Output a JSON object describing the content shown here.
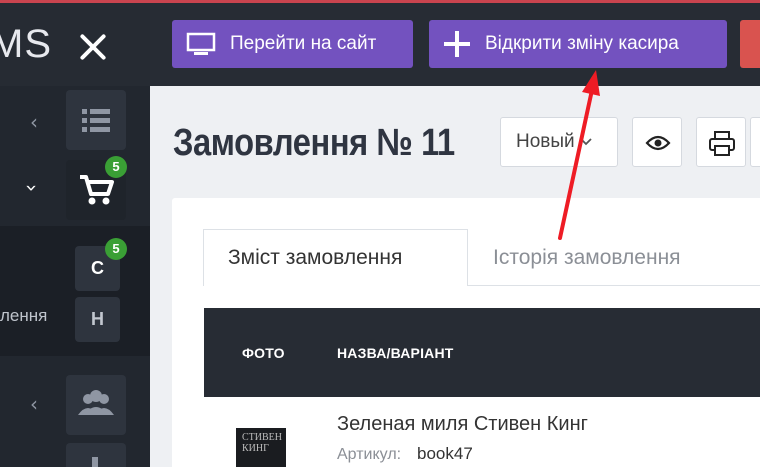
{
  "brand": {
    "logo_text": "MS"
  },
  "sidebar": {
    "badges": {
      "orders": "5",
      "sub_orders": "5"
    },
    "sub_items": {
      "first": "С",
      "second": "Н"
    },
    "section_label": "лення"
  },
  "topbar": {
    "go_to_site_label": "Перейти на сайт",
    "open_shift_label": "Відкрити зміну касира"
  },
  "order": {
    "title": "Замовлення № 11",
    "status_selected": "Новый"
  },
  "tabs": [
    {
      "label": "Зміст замовлення",
      "active": true
    },
    {
      "label": "Історія замовлення",
      "active": false
    }
  ],
  "table": {
    "headers": {
      "photo": "ФОТО",
      "name_variant": "НАЗВА/ВАРІАНТ"
    },
    "rows": [
      {
        "name": "Зеленая миля Стивен Кинг",
        "sku_label": "Артикул:",
        "sku": "book47",
        "image_text": "СТИВЕН КИНГ"
      }
    ]
  },
  "colors": {
    "accent": "#7352bf",
    "sidebar": "#22272f",
    "badge": "#3a9f35",
    "annotation_arrow": "#ee1c25"
  }
}
